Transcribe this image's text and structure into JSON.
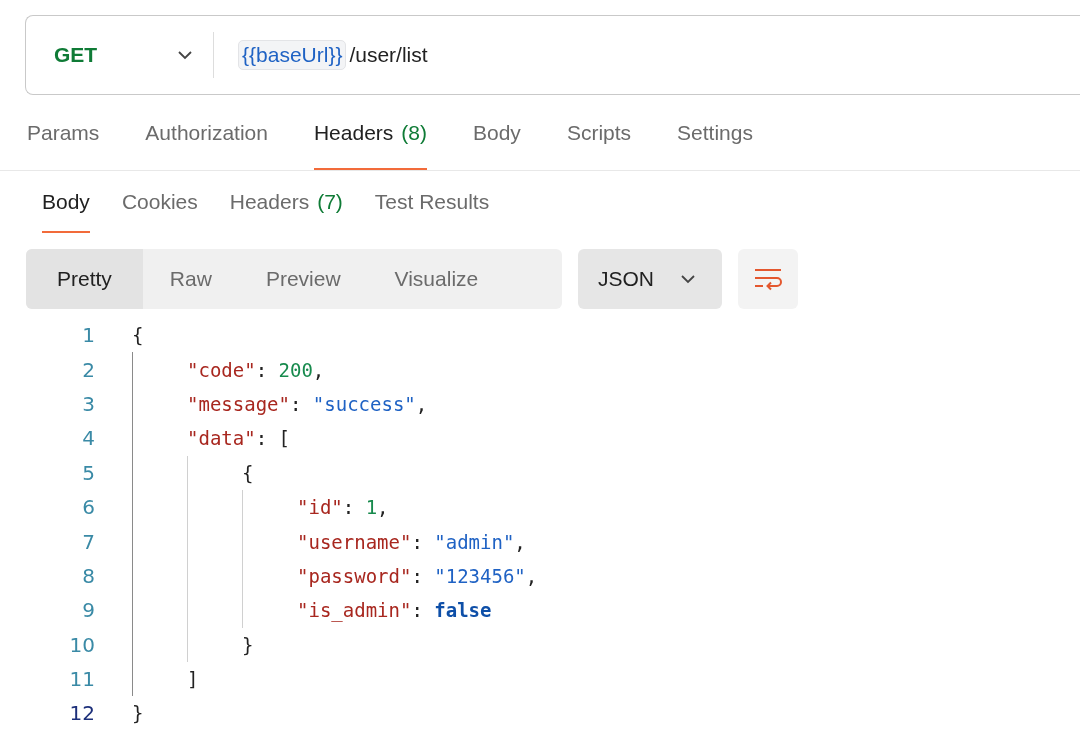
{
  "request": {
    "method": "GET",
    "url_variable": "{{baseUrl}}",
    "url_path": "/user/list"
  },
  "request_tabs": [
    {
      "label": "Params",
      "selected": false
    },
    {
      "label": "Authorization",
      "selected": false
    },
    {
      "label": "Headers",
      "count": "(8)",
      "selected": true
    },
    {
      "label": "Body",
      "selected": false
    },
    {
      "label": "Scripts",
      "selected": false
    },
    {
      "label": "Settings",
      "selected": false
    }
  ],
  "response_tabs": [
    {
      "label": "Body",
      "selected": true
    },
    {
      "label": "Cookies",
      "selected": false
    },
    {
      "label": "Headers",
      "count": "(7)",
      "selected": false
    },
    {
      "label": "Test Results",
      "selected": false
    }
  ],
  "view_modes": [
    {
      "label": "Pretty",
      "selected": true
    },
    {
      "label": "Raw",
      "selected": false
    },
    {
      "label": "Preview",
      "selected": false
    },
    {
      "label": "Visualize",
      "selected": false
    }
  ],
  "format": {
    "label": "JSON"
  },
  "code_lines": [
    {
      "number": "1",
      "selected": false,
      "tokens": [
        {
          "text": "{",
          "kind": "punct"
        }
      ],
      "children": [
        {
          "number": "2",
          "selected": false,
          "tokens": [
            {
              "text": "\"code\"",
              "kind": "key"
            },
            {
              "text": ": ",
              "kind": "punct"
            },
            {
              "text": "200",
              "kind": "number"
            },
            {
              "text": ",",
              "kind": "punct"
            }
          ]
        },
        {
          "number": "3",
          "selected": false,
          "tokens": [
            {
              "text": "\"message\"",
              "kind": "key"
            },
            {
              "text": ": ",
              "kind": "punct"
            },
            {
              "text": "\"success\"",
              "kind": "string"
            },
            {
              "text": ",",
              "kind": "punct"
            }
          ]
        },
        {
          "number": "4",
          "selected": false,
          "tokens": [
            {
              "text": "\"data\"",
              "kind": "key"
            },
            {
              "text": ": [",
              "kind": "punct"
            }
          ],
          "children": [
            {
              "number": "5",
              "selected": false,
              "tokens": [
                {
                  "text": "{",
                  "kind": "punct"
                }
              ],
              "children": [
                {
                  "number": "6",
                  "selected": false,
                  "tokens": [
                    {
                      "text": "\"id\"",
                      "kind": "key"
                    },
                    {
                      "text": ": ",
                      "kind": "punct"
                    },
                    {
                      "text": "1",
                      "kind": "number"
                    },
                    {
                      "text": ",",
                      "kind": "punct"
                    }
                  ]
                },
                {
                  "number": "7",
                  "selected": false,
                  "tokens": [
                    {
                      "text": "\"username\"",
                      "kind": "key"
                    },
                    {
                      "text": ": ",
                      "kind": "punct"
                    },
                    {
                      "text": "\"admin\"",
                      "kind": "string"
                    },
                    {
                      "text": ",",
                      "kind": "punct"
                    }
                  ]
                },
                {
                  "number": "8",
                  "selected": false,
                  "tokens": [
                    {
                      "text": "\"password\"",
                      "kind": "key"
                    },
                    {
                      "text": ": ",
                      "kind": "punct"
                    },
                    {
                      "text": "\"123456\"",
                      "kind": "string"
                    },
                    {
                      "text": ",",
                      "kind": "punct"
                    }
                  ]
                },
                {
                  "number": "9",
                  "selected": false,
                  "tokens": [
                    {
                      "text": "\"is_admin\"",
                      "kind": "key"
                    },
                    {
                      "text": ": ",
                      "kind": "punct"
                    },
                    {
                      "text": "false",
                      "kind": "keyword"
                    }
                  ]
                }
              ]
            },
            {
              "number": "10",
              "selected": false,
              "tokens": [
                {
                  "text": "}",
                  "kind": "punct"
                }
              ]
            }
          ]
        },
        {
          "number": "11",
          "selected": false,
          "tokens": [
            {
              "text": "]",
              "kind": "punct"
            }
          ]
        }
      ]
    },
    {
      "number": "12",
      "selected": true,
      "tokens": [
        {
          "text": "}",
          "kind": "punct"
        }
      ]
    }
  ]
}
